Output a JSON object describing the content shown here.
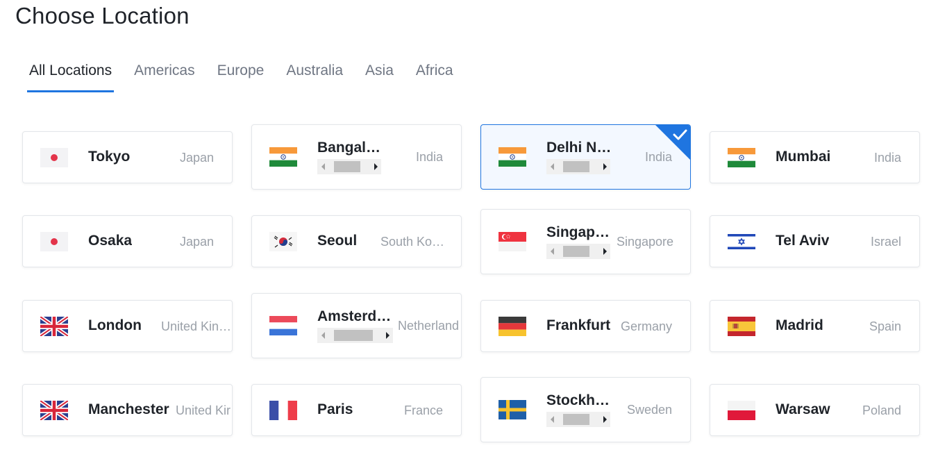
{
  "title": "Choose Location",
  "tabs": [
    "All Locations",
    "Americas",
    "Europe",
    "Australia",
    "Asia",
    "Africa"
  ],
  "active_tab": "All Locations",
  "accent_color": "#1f75e0",
  "locations": [
    {
      "city": "Tokyo",
      "country": "Japan",
      "flag": "japan-flag"
    },
    {
      "city": "Bangal…",
      "country": "India",
      "flag": "india-flag",
      "scrollbar": true
    },
    {
      "city": "Delhi N…",
      "country": "India",
      "flag": "india-flag",
      "scrollbar": true,
      "selected": true
    },
    {
      "city": "Mumbai",
      "country": "India",
      "flag": "india-flag"
    },
    {
      "city": "Osaka",
      "country": "Japan",
      "flag": "japan-flag"
    },
    {
      "city": "Seoul",
      "country": "South Ko…",
      "flag": "south-korea-flag"
    },
    {
      "city": "Singap…",
      "country": "Singapore",
      "flag": "singapore-flag",
      "scrollbar": true
    },
    {
      "city": "Tel Aviv",
      "country": "Israel",
      "flag": "israel-flag"
    },
    {
      "city": "London",
      "country": "United Kin…",
      "flag": "united-kingdom-flag"
    },
    {
      "city": "Amsterd…",
      "country": "Netherland",
      "flag": "netherlands-flag",
      "scrollbar": true
    },
    {
      "city": "Frankfurt",
      "country": "Germany",
      "flag": "germany-flag"
    },
    {
      "city": "Madrid",
      "country": "Spain",
      "flag": "spain-flag"
    },
    {
      "city": "Manchester",
      "country": "United Kir",
      "flag": "united-kingdom-flag"
    },
    {
      "city": "Paris",
      "country": "France",
      "flag": "france-flag"
    },
    {
      "city": "Stockh…",
      "country": "Sweden",
      "flag": "sweden-flag",
      "scrollbar": true
    },
    {
      "city": "Warsaw",
      "country": "Poland",
      "flag": "poland-flag"
    }
  ]
}
